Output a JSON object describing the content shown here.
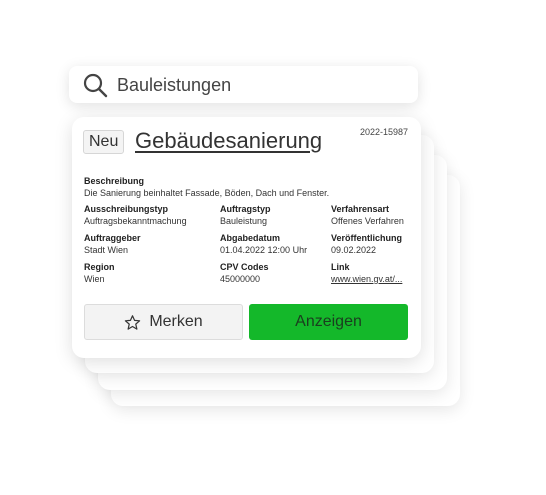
{
  "search": {
    "query": "Bauleistungen",
    "icon": "search-icon"
  },
  "card": {
    "badge": "Neu",
    "title": "Gebäudesanierung",
    "ref_number": "2022-15987",
    "description": {
      "label": "Beschreibung",
      "value": "Die Sanierung beinhaltet Fassade, Böden, Dach und Fenster."
    },
    "fields": [
      {
        "label": "Ausschreibungstyp",
        "value": "Auftragsbekanntmachung"
      },
      {
        "label": "Auftragstyp",
        "value": "Bauleistung"
      },
      {
        "label": "Verfahrensart",
        "value": "Offenes Verfahren"
      },
      {
        "label": "Auftraggeber",
        "value": "Stadt Wien"
      },
      {
        "label": "Abgabedatum",
        "value": "01.04.2022 12:00 Uhr"
      },
      {
        "label": "Veröffentlichung",
        "value": "09.02.2022"
      },
      {
        "label": "Region",
        "value": "Wien"
      },
      {
        "label": "CPV Codes",
        "value": "45000000"
      },
      {
        "label": "Link",
        "value": "www.wien.gv.at/..."
      }
    ],
    "buttons": {
      "bookmark": "Merken",
      "show": "Anzeigen"
    }
  },
  "colors": {
    "accent": "#14b82a",
    "badge_bg": "#f4f4f4"
  }
}
